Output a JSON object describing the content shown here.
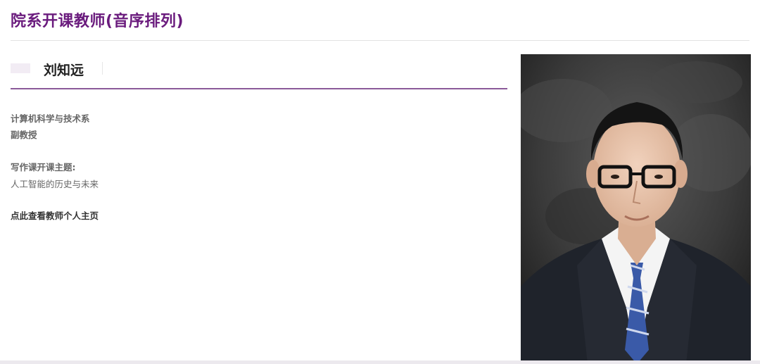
{
  "header": {
    "title": "院系开课教师(音序排列)"
  },
  "teacher": {
    "name": "刘知远",
    "department": "计算机科学与技术系",
    "rank": "副教授",
    "topic_label": "写作课开课主题:",
    "topic": "人工智能的历史与未来",
    "homepage_link": "点此查看教师个人主页"
  },
  "colors": {
    "accent": "#6a1b7d",
    "underline": "#8b5a9a"
  }
}
